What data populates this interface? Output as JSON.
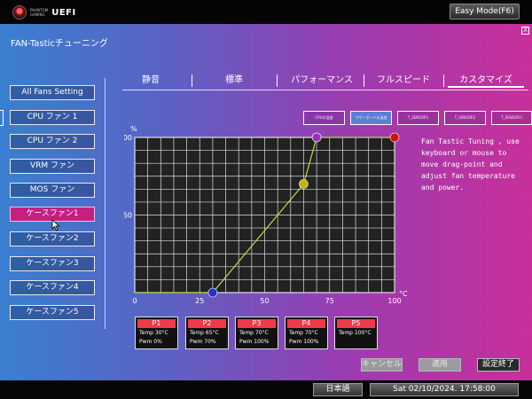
{
  "header": {
    "brand_top": "PHANTOM",
    "brand_bottom": "GAMING",
    "brand_main": "UEFI",
    "easy_mode": "Easy Mode(F6)"
  },
  "page": {
    "title": "FAN-Tasticチューニング",
    "close": "X"
  },
  "sidebar": {
    "items": [
      {
        "label": "All Fans Setting"
      },
      {
        "label": "CPU ファン 1"
      },
      {
        "label": "CPU ファン 2"
      },
      {
        "label": "VRM ファン"
      },
      {
        "label": "MOS ファン"
      },
      {
        "label": "ケースファン1"
      },
      {
        "label": "ケースファン2"
      },
      {
        "label": "ケースファン3"
      },
      {
        "label": "ケースファン4"
      },
      {
        "label": "ケースファン5"
      }
    ],
    "active_index": 5
  },
  "tabs": [
    {
      "label": "静音"
    },
    {
      "label": "標準"
    },
    {
      "label": "パフォーマンス"
    },
    {
      "label": "フルスピード"
    },
    {
      "label": "カスタマイズ"
    }
  ],
  "sensors": [
    {
      "label": "CPUの温度"
    },
    {
      "label": "マザーボードの温度"
    },
    {
      "label": "T_SENSOR1"
    },
    {
      "label": "T_SENSOR2"
    },
    {
      "label": "T_SENSOR3"
    }
  ],
  "description": "Fan Tastic Tuning , use keyboard or mouse to move drag-point and adjust fan temperature and power.",
  "chart_data": {
    "type": "line",
    "ylabel": "%",
    "xlabel": "°C",
    "x_ticks": [
      "0",
      "25",
      "50",
      "75",
      "100"
    ],
    "y_ticks": [
      "100",
      "50",
      "0"
    ],
    "xlim": [
      0,
      100
    ],
    "ylim": [
      0,
      100
    ],
    "grid": true,
    "points": [
      {
        "name": "P1",
        "temp": 30,
        "pwm": 0,
        "color": "#2233cc"
      },
      {
        "name": "P2",
        "temp": 65,
        "pwm": 70,
        "color": "#c8b400"
      },
      {
        "name": "P3",
        "temp": 70,
        "pwm": 100,
        "color": "#9a30c0"
      },
      {
        "name": "P4",
        "temp": 70,
        "pwm": 100,
        "color": "#9a30c0"
      },
      {
        "name": "P5",
        "temp": 100,
        "pwm": 100,
        "color": "#d01010"
      }
    ],
    "line_color": "#b8e040"
  },
  "point_cards": [
    {
      "title": "P1",
      "temp": "Temp 30°C",
      "pwm": "Pwm   0%"
    },
    {
      "title": "P2",
      "temp": "Temp 65°C",
      "pwm": "Pwm  70%"
    },
    {
      "title": "P3",
      "temp": "Temp 70°C",
      "pwm": "Pwm  100%"
    },
    {
      "title": "P4",
      "temp": "Temp 70°C",
      "pwm": "Pwm  100%"
    },
    {
      "title": "P5",
      "temp": "Temp 100°C",
      "pwm": ""
    }
  ],
  "actions": {
    "cancel": "キャンセル",
    "apply": "適用",
    "finish": "設定終了"
  },
  "footer": {
    "language": "日本語",
    "datetime": "Sat 02/10/2024. 17:58:00"
  }
}
